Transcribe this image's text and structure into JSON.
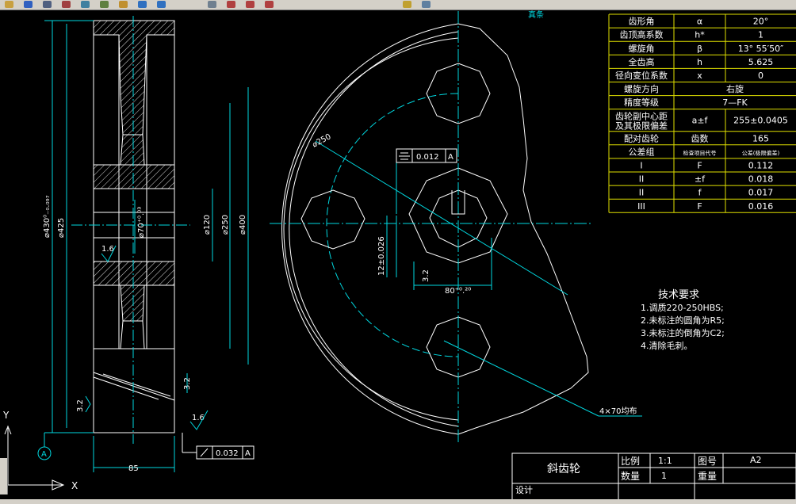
{
  "toolbar": {
    "icons": [
      "open-icon",
      "save-icon",
      "print-icon",
      "cut-icon",
      "copy-icon",
      "paste-icon",
      "match-icon",
      "undo-icon",
      "redo-icon",
      "pan-icon",
      "zoom-icon",
      "zoom-window-icon",
      "zoom-prev-icon",
      "layer-icon",
      "properties-icon"
    ],
    "partial_label": "真条"
  },
  "colors": {
    "background": "#000000",
    "line_white": "#ffffff",
    "line_cyan": "#00d8e0",
    "line_yellow": "#ffff66",
    "hatch": "#e0e0e0",
    "toolbar_bg": "#d4d0c8"
  },
  "dims": {
    "d430": "⌀430⁰₋₀.₀₉₇",
    "d425": "⌀425",
    "d120": "⌀120",
    "d250": "⌀250",
    "d400": "⌀400",
    "d70": "⌀70⁺⁰.⁰³",
    "r250": "⌀250",
    "width85": "85",
    "keyway": "12±0.026",
    "bore": "80⁺⁰.²⁰",
    "holes": "4×70均布",
    "rough1": "1.6",
    "rough2": "1.6",
    "rough3": "3.2",
    "rough4": "3.2",
    "rough5": "3.2",
    "tol_sym": "0.012",
    "tol_sym_ref": "A",
    "tol_run": "0.032",
    "tol_run_ref": "A",
    "datum": "A"
  },
  "gear_table": {
    "rows": [
      {
        "name": "齿形角",
        "sym": "α",
        "val": "20°"
      },
      {
        "name": "齿顶高系数",
        "sym": "h*",
        "val": "1"
      },
      {
        "name": "螺旋角",
        "sym": "β",
        "val": "13° 55′50″"
      },
      {
        "name": "全齿高",
        "sym": "h",
        "val": "5.625"
      },
      {
        "name": "径向变位系数",
        "sym": "x",
        "val": "0"
      },
      {
        "name": "螺旋方向",
        "sym": "",
        "val": "右旋"
      },
      {
        "name": "精度等级",
        "sym": "",
        "val": "7—FK"
      },
      {
        "name": "齿轮副中心距",
        "name2": "及其极限偏差",
        "sym": "a±f",
        "val": "255±0.0405"
      },
      {
        "name": "配对齿轮",
        "sym": "齿数",
        "val": "165"
      },
      {
        "name": "公差组",
        "sym": "检查项目代号",
        "val": "公差(极限偏差)"
      },
      {
        "name": "I",
        "sym": "F",
        "val": "0.112"
      },
      {
        "name": "II",
        "sym": "±f",
        "val": "0.018"
      },
      {
        "name": "II",
        "sym": "f",
        "val": "0.017"
      },
      {
        "name": "III",
        "sym": "F",
        "val": "0.016"
      }
    ]
  },
  "tech_req": {
    "title": "技术要求",
    "items": [
      "1.调质220-250HBS;",
      "2.未标注的圆角为R5;",
      "3.未标注的倒角为C2;",
      "4.清除毛刺。"
    ]
  },
  "title_block": {
    "part_name": "斜齿轮",
    "scale_label": "比例",
    "scale_value": "1:1",
    "qty_label": "数量",
    "qty_value": "1",
    "drawing_no_label": "图号",
    "drawing_no_value": "A2",
    "weight_label": "重量",
    "design_label": "设计"
  },
  "ucs": {
    "y": "Y",
    "x": "X"
  }
}
